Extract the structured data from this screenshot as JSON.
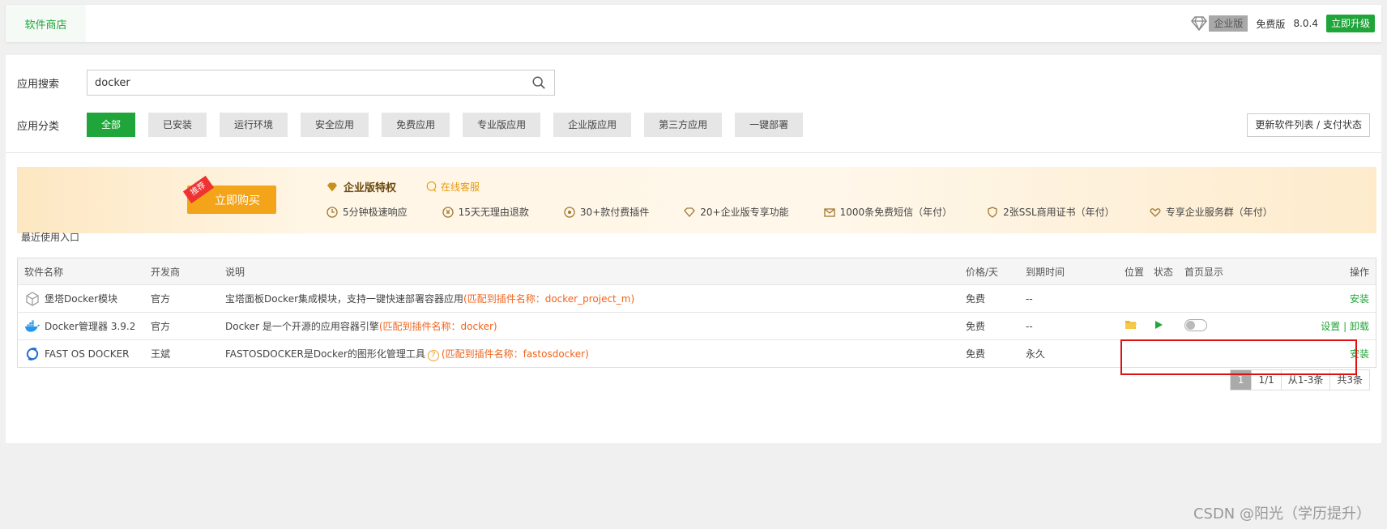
{
  "topbar": {
    "tab_label": "软件商店",
    "edition_label": "企业版",
    "free_label": "免费版",
    "version": "8.0.4",
    "upgrade_label": "立即升级"
  },
  "search": {
    "label": "应用搜索",
    "value": "docker",
    "icon": "search-icon"
  },
  "categories": {
    "label": "应用分类",
    "items": [
      "全部",
      "已安装",
      "运行环境",
      "安全应用",
      "免费应用",
      "专业版应用",
      "企业版应用",
      "第三方应用",
      "一键部署"
    ],
    "active_index": 0,
    "refresh_label": "更新软件列表 / 支付状态"
  },
  "banner": {
    "recommend_badge": "推荐",
    "buy_label": "立即购买",
    "title": "企业版特权",
    "online_label": "在线客服",
    "features": [
      "5分钟极速响应",
      "15天无理由退款",
      "30+款付费插件",
      "20+企业版专享功能",
      "1000条免费短信（年付）",
      "2张SSL商用证书（年付）",
      "专享企业服务群（年付）"
    ]
  },
  "recent_label": "最近使用入口",
  "table": {
    "headers": {
      "name": "软件名称",
      "dev": "开发商",
      "desc": "说明",
      "price": "价格/天",
      "expire": "到期时间",
      "position": "位置",
      "status": "状态",
      "home": "首页显示",
      "op": "操作"
    },
    "rows": [
      {
        "name": "堡塔Docker模块",
        "dev": "官方",
        "desc": "宝塔面板Docker集成模块，支持一键快速部署容器应用",
        "match": "(匹配到插件名称：docker_project_m)",
        "price": "免费",
        "expire": "--",
        "op": "安装"
      },
      {
        "name": "Docker管理器 3.9.2",
        "dev": "官方",
        "desc": "Docker 是一个开源的应用容器引擎",
        "match": "(匹配到插件名称：docker)",
        "price": "免费",
        "expire": "--",
        "op_settings": "设置",
        "op_sep": "|",
        "op_uninstall": "卸载"
      },
      {
        "name": "FAST OS DOCKER",
        "dev": "王斌",
        "desc": "FASTOSDOCKER是Docker的图形化管理工具",
        "help": "?",
        "match": "(匹配到插件名称：fastosdocker)",
        "price": "免费",
        "expire": "永久",
        "op": "安装"
      }
    ]
  },
  "pager": {
    "current": "1",
    "pages": "1/1",
    "range": "从1-3条",
    "total": "共3条"
  },
  "watermark": "CSDN @阳光（学历提升）",
  "colors": {
    "accent": "#20a53a",
    "match": "#f0641c",
    "highlight": "#e01010"
  }
}
